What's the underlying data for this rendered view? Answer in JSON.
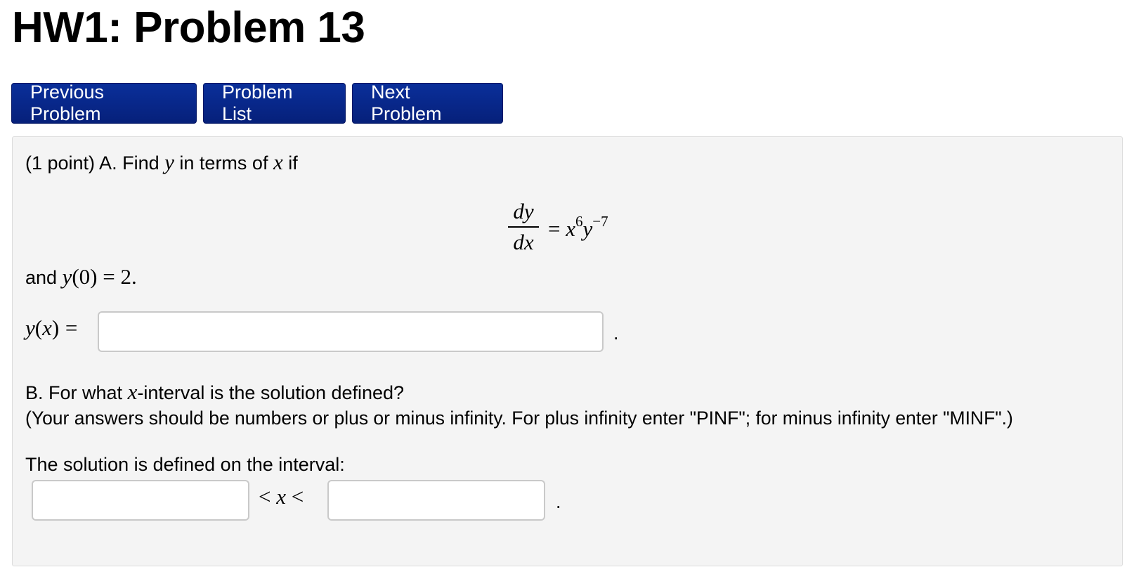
{
  "page": {
    "title": "HW1: Problem 13"
  },
  "nav": {
    "previous_label": "Previous Problem",
    "list_label": "Problem List",
    "next_label": "Next Problem"
  },
  "problem": {
    "part_a": {
      "intro_prefix": "(1 point) A. Find",
      "var_y": "y",
      "intro_mid": "in terms of",
      "var_x": "x",
      "intro_suffix": "if",
      "equation": {
        "numerator": "dy",
        "denominator": "dx",
        "equals": "=",
        "x_base": "x",
        "x_exp": "6",
        "y_base": "y",
        "y_exp": "−7"
      },
      "condition_prefix": "and",
      "condition_fn": "y",
      "condition_value": "(0) = 2.",
      "answer_label_fn": "y",
      "answer_label_arg": "x",
      "answer_label_rest": "=",
      "answer_value": "",
      "answer_end": "."
    },
    "part_b": {
      "question_prefix": "B. For what",
      "question_var": "x",
      "question_suffix": "-interval is the solution defined?",
      "instructions": "(Your answers should be numbers or plus or minus infinity. For plus infinity enter \"PINF\"; for minus infinity enter \"MINF\".)",
      "interval_label": "The solution is defined on the interval:",
      "lower_value": "",
      "inequality_lt1": "<",
      "inequality_var": "x",
      "inequality_lt2": "<",
      "upper_value": "",
      "answer_end": "."
    }
  }
}
